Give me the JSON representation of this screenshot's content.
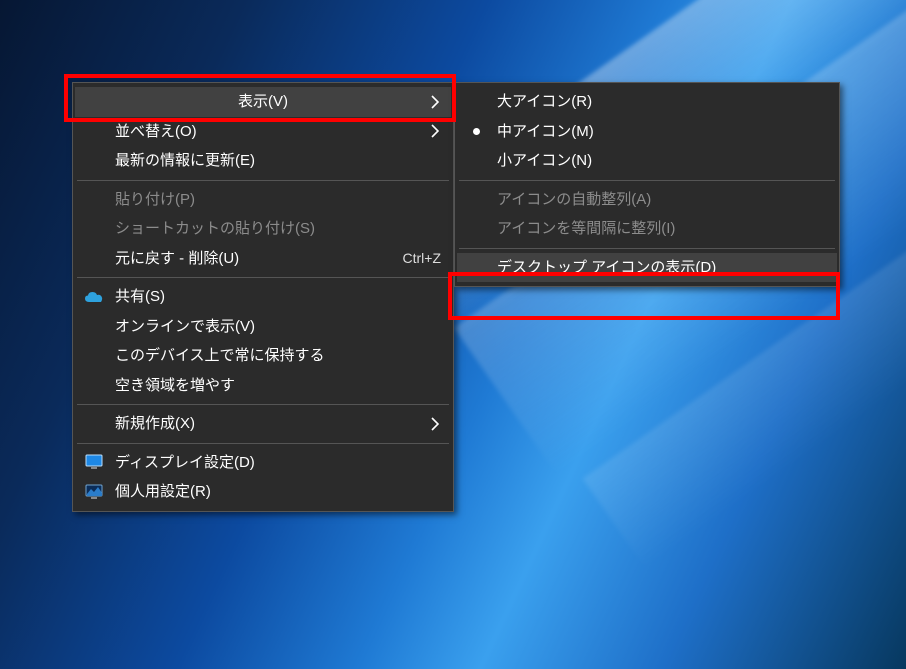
{
  "primary_menu": {
    "view": "表示(V)",
    "sort": "並べ替え(O)",
    "refresh": "最新の情報に更新(E)",
    "paste": "貼り付け(P)",
    "paste_shortcut": "ショートカットの貼り付け(S)",
    "undo_delete": "元に戻す - 削除(U)",
    "undo_delete_key": "Ctrl+Z",
    "share": "共有(S)",
    "view_online": "オンラインで表示(V)",
    "always_keep": "このデバイス上で常に保持する",
    "free_up_space": "空き領域を増やす",
    "new": "新規作成(X)",
    "display_settings": "ディスプレイ設定(D)",
    "personalize": "個人用設定(R)"
  },
  "sub_menu": {
    "large_icons": "大アイコン(R)",
    "medium_icons": "中アイコン(M)",
    "small_icons": "小アイコン(N)",
    "auto_arrange": "アイコンの自動整列(A)",
    "align_to_grid": "アイコンを等間隔に整列(I)",
    "show_desktop_icons": "デスクトップ アイコンの表示(D)"
  }
}
